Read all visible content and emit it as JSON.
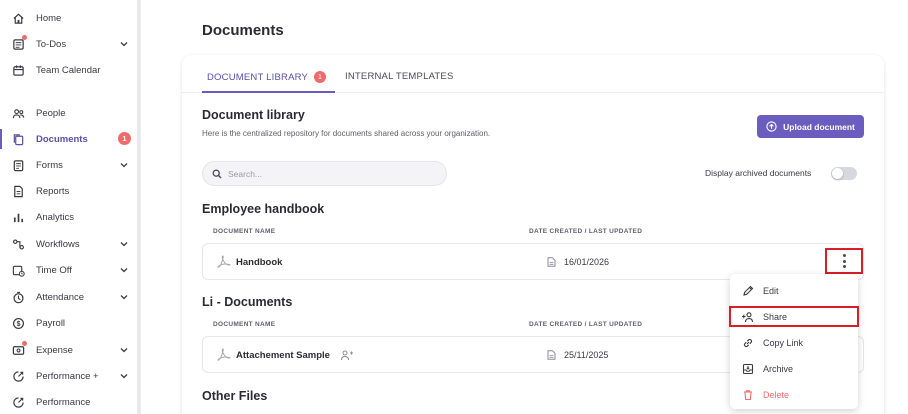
{
  "sidebar": {
    "items": [
      {
        "label": "Home",
        "icon": "home-icon"
      },
      {
        "label": "To-Dos",
        "icon": "todo-icon",
        "has_dot": true,
        "expandable": true
      },
      {
        "label": "Team Calendar",
        "icon": "calendar-icon"
      },
      {
        "label": "People",
        "icon": "people-icon"
      },
      {
        "label": "Documents",
        "icon": "documents-icon",
        "badge": "1",
        "active": true
      },
      {
        "label": "Forms",
        "icon": "forms-icon",
        "expandable": true
      },
      {
        "label": "Reports",
        "icon": "reports-icon"
      },
      {
        "label": "Analytics",
        "icon": "analytics-icon"
      },
      {
        "label": "Workflows",
        "icon": "workflows-icon",
        "expandable": true
      },
      {
        "label": "Time Off",
        "icon": "time-off-icon",
        "expandable": true
      },
      {
        "label": "Attendance",
        "icon": "attendance-icon",
        "expandable": true
      },
      {
        "label": "Payroll",
        "icon": "payroll-icon"
      },
      {
        "label": "Expense",
        "icon": "expense-icon",
        "has_dot": true,
        "expandable": true
      },
      {
        "label": "Performance +",
        "icon": "performance-plus-icon",
        "expandable": true
      },
      {
        "label": "Performance",
        "icon": "performance-icon"
      }
    ]
  },
  "page": {
    "title": "Documents"
  },
  "tabs": [
    {
      "label": "DOCUMENT LIBRARY",
      "badge": "1",
      "active": true
    },
    {
      "label": "INTERNAL TEMPLATES",
      "active": false
    }
  ],
  "library": {
    "title": "Document library",
    "subtitle": "Here is the centralized repository for documents shared across your organization.",
    "upload_label": "Upload document",
    "search_placeholder": "Search...",
    "archived_label": "Display archived documents",
    "archived_on": false
  },
  "sections": [
    {
      "title": "Employee handbook",
      "col_name": "DOCUMENT NAME",
      "col_date": "DATE CREATED / LAST UPDATED",
      "docs": [
        {
          "name": "Handbook",
          "date": "16/01/2026"
        }
      ]
    },
    {
      "title": "Li - Documents",
      "col_name": "DOCUMENT NAME",
      "col_date": "DATE CREATED / LAST UPDATED",
      "docs": [
        {
          "name": "Attachement Sample",
          "date": "25/11/2025",
          "shared": true
        }
      ]
    },
    {
      "title": "Other Files"
    }
  ],
  "context_menu": {
    "items": [
      {
        "label": "Edit",
        "icon": "pencil-icon"
      },
      {
        "label": "Share",
        "icon": "share-user-icon",
        "highlighted": true
      },
      {
        "label": "Copy Link",
        "icon": "link-icon"
      },
      {
        "label": "Archive",
        "icon": "archive-icon"
      },
      {
        "label": "Delete",
        "icon": "trash-icon",
        "danger": true
      }
    ]
  },
  "colors": {
    "accent": "#6b5cc0",
    "badge": "#ef6b6b",
    "highlight_box": "#d81f26",
    "danger": "#ef6b6b"
  }
}
